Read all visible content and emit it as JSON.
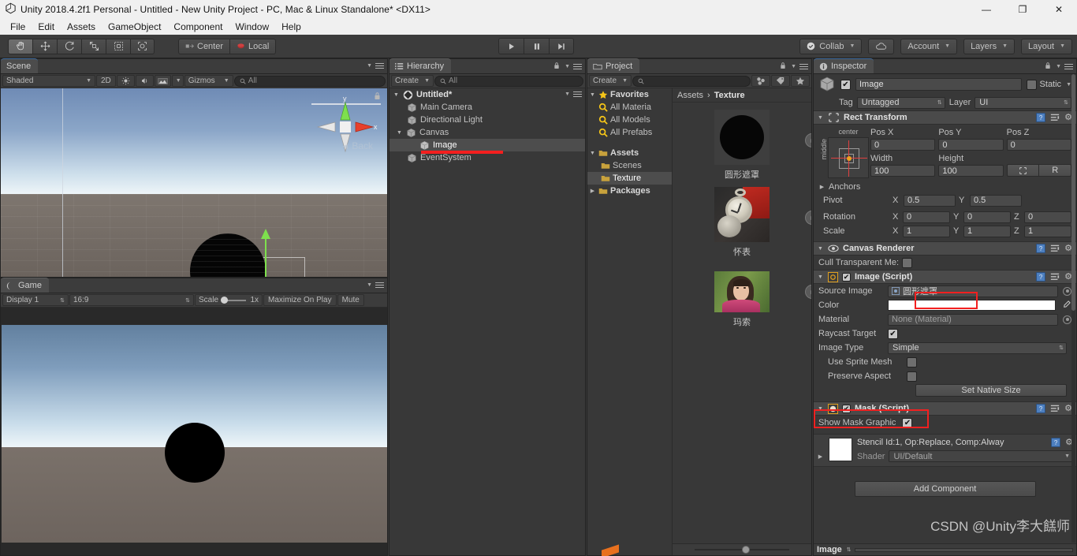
{
  "window": {
    "title": "Unity 2018.4.2f1 Personal - Untitled - New Unity Project - PC, Mac & Linux Standalone* <DX11>",
    "app_icon": "unity-logo-icon",
    "minimize": "—",
    "maximize": "❐",
    "close": "✕"
  },
  "menubar": {
    "items": [
      "File",
      "Edit",
      "Assets",
      "GameObject",
      "Component",
      "Window",
      "Help"
    ]
  },
  "toolbar": {
    "transform_tools": [
      {
        "name": "hand-tool",
        "glyph": "✋",
        "active": true
      },
      {
        "name": "move-tool",
        "glyph": "✚",
        "active": false
      },
      {
        "name": "rotate-tool",
        "glyph": "↻",
        "active": false
      },
      {
        "name": "scale-tool",
        "glyph": "⤢",
        "active": false
      },
      {
        "name": "rect-tool",
        "glyph": "⧉",
        "active": false
      },
      {
        "name": "transform-tool",
        "glyph": "✤",
        "active": false
      }
    ],
    "pivot_label": "Center",
    "rotation_label": "Local",
    "play": "▶",
    "pause": "❙❙",
    "step": "▶❙",
    "collab_label": "Collab",
    "cloud_label": "cloud-icon",
    "account_label": "Account",
    "layers_label": "Layers",
    "layout_label": "Layout"
  },
  "scene": {
    "tab": "Scene",
    "shading_mode": "Shaded",
    "twod_label": "2D",
    "lighting_icon": "sun-icon",
    "audio_icon": "speaker-icon",
    "fx_icon": "image-effects-icon",
    "gizmos_label": "Gizmos",
    "search_placeholder": "All",
    "gizmo_view_label": "Back",
    "axis_x": "x",
    "axis_y": "y"
  },
  "game": {
    "tab": "Game",
    "display": "Display 1",
    "aspect": "16:9",
    "scale_label": "Scale",
    "scale_value": "1x",
    "maximize_label": "Maximize On Play",
    "mute_label": "Mute"
  },
  "hierarchy": {
    "tab": "Hierarchy",
    "create_label": "Create",
    "search_placeholder": "All",
    "scene_root": "Untitled*",
    "items": [
      {
        "label": "Main Camera",
        "depth": 1,
        "expandable": false,
        "selected": false
      },
      {
        "label": "Directional Light",
        "depth": 1,
        "expandable": false,
        "selected": false
      },
      {
        "label": "Canvas",
        "depth": 1,
        "expandable": true,
        "selected": false
      },
      {
        "label": "Image",
        "depth": 2,
        "expandable": false,
        "selected": true
      },
      {
        "label": "EventSystem",
        "depth": 1,
        "expandable": false,
        "selected": false
      }
    ]
  },
  "project": {
    "tab": "Project",
    "create_label": "Create",
    "search_placeholder": "",
    "tree": [
      {
        "label": "Favorites",
        "depth": 0,
        "icon": "star-icon",
        "expandable": true,
        "selected": false,
        "bold": true
      },
      {
        "label": "All Materia",
        "depth": 1,
        "icon": "search-icon",
        "expandable": false,
        "selected": false,
        "bold": false
      },
      {
        "label": "All Models",
        "depth": 1,
        "icon": "search-icon",
        "expandable": false,
        "selected": false,
        "bold": false
      },
      {
        "label": "All Prefabs",
        "depth": 1,
        "icon": "search-icon",
        "expandable": false,
        "selected": false,
        "bold": false
      },
      {
        "label": "Assets",
        "depth": 0,
        "icon": "folder-icon",
        "expandable": true,
        "selected": false,
        "bold": true
      },
      {
        "label": "Scenes",
        "depth": 1,
        "icon": "folder-icon",
        "expandable": false,
        "selected": false,
        "bold": false
      },
      {
        "label": "Texture",
        "depth": 1,
        "icon": "folder-icon",
        "expandable": false,
        "selected": true,
        "bold": false
      },
      {
        "label": "Packages",
        "depth": 0,
        "icon": "folder-icon",
        "expandable": true,
        "selected": false,
        "bold": true
      }
    ],
    "breadcrumb_root": "Assets",
    "breadcrumb_sep": "›",
    "breadcrumb_current": "Texture",
    "assets": [
      {
        "label": "圆形遮罩",
        "kind": "black-circle"
      },
      {
        "label": "怀表",
        "kind": "pocket-watch-photo"
      },
      {
        "label": "玛索",
        "kind": "girl-photo"
      }
    ]
  },
  "inspector": {
    "tab": "Inspector",
    "object_name": "Image",
    "enabled": true,
    "static_label": "Static",
    "tag_label": "Tag",
    "tag_value": "Untagged",
    "layer_label": "Layer",
    "layer_value": "UI",
    "rect_transform": {
      "title": "Rect Transform",
      "anchor_preset_top": "center",
      "anchor_preset_side": "middle",
      "pos_x_label": "Pos X",
      "pos_x": "0",
      "pos_y_label": "Pos Y",
      "pos_y": "0",
      "pos_z_label": "Pos Z",
      "pos_z": "0",
      "width_label": "Width",
      "width": "100",
      "height_label": "Height",
      "height": "100",
      "blueprint_label": "",
      "raw_label": "R",
      "anchors_label": "Anchors",
      "pivot_label": "Pivot",
      "pivot_x": "0.5",
      "pivot_y": "0.5",
      "rotation_label": "Rotation",
      "rot_x": "0",
      "rot_y": "0",
      "rot_z": "0",
      "scale_label": "Scale",
      "scale_x": "1",
      "scale_y": "1",
      "scale_z": "1",
      "axis_x": "X",
      "axis_y": "Y",
      "axis_z": "Z"
    },
    "canvas_renderer": {
      "title": "Canvas Renderer",
      "cull_label": "Cull Transparent Me:",
      "cull_checked": false
    },
    "image_script": {
      "title": "Image (Script)",
      "enabled": true,
      "source_image_label": "Source Image",
      "source_image_value": "圆形遮罩",
      "color_label": "Color",
      "color_value": "#FFFFFF",
      "material_label": "Material",
      "material_value": "None (Material)",
      "raycast_label": "Raycast Target",
      "raycast_checked": true,
      "image_type_label": "Image Type",
      "image_type_value": "Simple",
      "use_sprite_mesh_label": "Use Sprite Mesh",
      "use_sprite_mesh_checked": false,
      "preserve_aspect_label": "Preserve Aspect",
      "preserve_aspect_checked": false,
      "set_native_size_label": "Set Native Size"
    },
    "mask_script": {
      "title": "Mask (Script)",
      "enabled": true,
      "show_mask_graphic_label": "Show Mask Graphic",
      "show_mask_graphic_checked": true
    },
    "material_block": {
      "title": "Stencil Id:1, Op:Replace, Comp:Alway",
      "shader_label": "Shader",
      "shader_value": "UI/Default"
    },
    "add_component_label": "Add Component",
    "footer_name": "Image"
  },
  "watermark": "CSDN @Unity李大餻师",
  "colors": {
    "panel_bg": "#383838",
    "header_bg": "#4a4a4a",
    "accent_red": "#f22020",
    "selection": "#4d4d4d",
    "folder_yellow": "#f0c040",
    "tab_blue": "#3e6b9e"
  }
}
